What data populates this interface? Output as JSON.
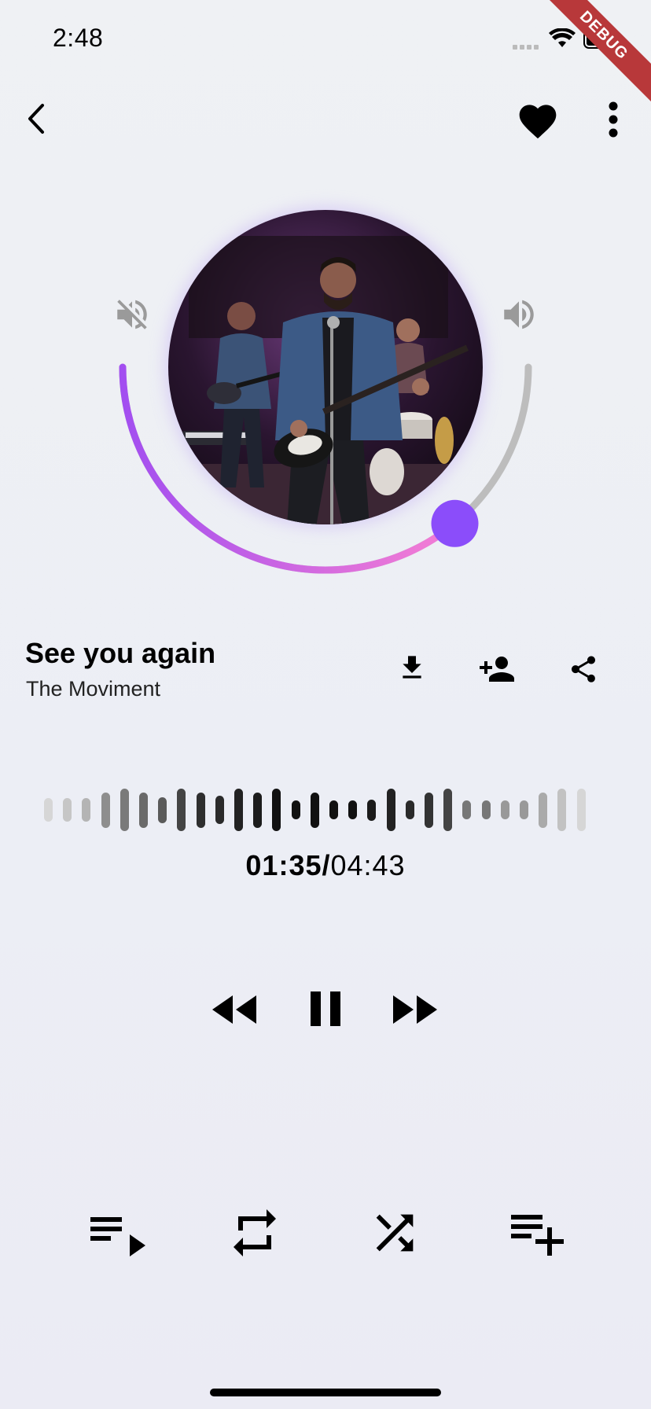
{
  "status_bar": {
    "time": "2:48"
  },
  "debug_banner": "DEBUG",
  "track": {
    "title": "See you again",
    "artist": "The Moviment"
  },
  "volume": {
    "level": 0.72
  },
  "playback": {
    "elapsed": "01:35/",
    "total": "04:43",
    "progress": 0.34
  },
  "colors": {
    "accent": "#8b4dfa",
    "arc_start": "#a24ef0",
    "arc_end": "#ef7ad6",
    "track_gray": "#bdbdbd"
  },
  "icons": {
    "back": "chevron-left",
    "favorite": "heart",
    "more": "vertical-dots",
    "mute": "volume-off",
    "volume": "volume-up",
    "download": "download",
    "add_person": "person-add",
    "share": "share",
    "rewind": "fast-rewind",
    "pause": "pause",
    "forward": "fast-forward",
    "queue": "playlist-play",
    "repeat": "repeat",
    "shuffle": "shuffle",
    "add_playlist": "playlist-add"
  }
}
